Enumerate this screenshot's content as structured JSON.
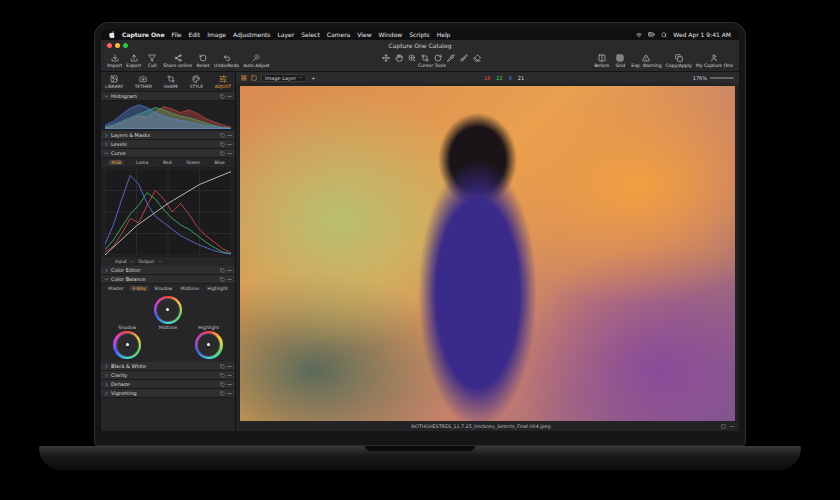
{
  "menu_bar": {
    "app": "Capture One",
    "items": [
      "File",
      "Edit",
      "Image",
      "Adjustments",
      "Layer",
      "Select",
      "Camera",
      "View",
      "Window",
      "Scripts",
      "Help"
    ],
    "clock": "Wed Apr 1  9:41 AM"
  },
  "window": {
    "title": "Capture One Catalog"
  },
  "toolbar": {
    "left": [
      "Import",
      "Export",
      "Cull",
      "Share online",
      "Reset",
      "Undo/Redo",
      "Auto Adjust"
    ],
    "center": "Cursor Tools",
    "right": [
      "Before",
      "Grid",
      "Exp. Warning",
      "Copy/Apply",
      "My Capture One"
    ]
  },
  "viewer_bar": {
    "layer": "Image Layer",
    "add": "+",
    "readings": [
      {
        "value": "24",
        "color": "#e5484d"
      },
      {
        "value": "22",
        "color": "#46c35a"
      },
      {
        "value": "6",
        "color": "#4a8cf0"
      },
      {
        "value": "21",
        "color": "#d8d8d8"
      }
    ],
    "zoom": "176%"
  },
  "tool_tabs": [
    {
      "label": "LIBRARY",
      "selected": false
    },
    {
      "label": "TETHER",
      "selected": false
    },
    {
      "label": "SHAPE",
      "selected": false
    },
    {
      "label": "STYLE",
      "selected": false
    },
    {
      "label": "ADJUST",
      "selected": true
    }
  ],
  "histogram": {
    "title": "Histogram",
    "expanded": true,
    "series": [
      {
        "name": "Red",
        "color": "#e0504a",
        "values": [
          2,
          6,
          14,
          22,
          30,
          28,
          40,
          52,
          46,
          38,
          44,
          36,
          24,
          16,
          10,
          4
        ]
      },
      {
        "name": "Green",
        "color": "#4cc070",
        "values": [
          4,
          10,
          18,
          26,
          34,
          42,
          50,
          44,
          36,
          30,
          26,
          20,
          14,
          8,
          4,
          2
        ]
      },
      {
        "name": "Blue",
        "color": "#5a8cf0",
        "values": [
          8,
          18,
          34,
          48,
          56,
          50,
          38,
          30,
          24,
          20,
          16,
          12,
          8,
          6,
          3,
          1
        ]
      }
    ]
  },
  "sections_top": [
    {
      "title": "Layers & Masks",
      "expanded": false
    },
    {
      "title": "Levels",
      "expanded": false
    }
  ],
  "curve": {
    "title": "Curve",
    "expanded": true,
    "tabs": [
      {
        "label": "RGB",
        "selected": true
      },
      {
        "label": "Luma",
        "selected": false
      },
      {
        "label": "Red",
        "selected": false
      },
      {
        "label": "Green",
        "selected": false
      },
      {
        "label": "Blue",
        "selected": false
      }
    ],
    "series": [
      {
        "name": "Red",
        "color": "#e0504a",
        "values": [
          3,
          8,
          20,
          34,
          30,
          46,
          60,
          52,
          40,
          48,
          38,
          26,
          18,
          12,
          6,
          2
        ]
      },
      {
        "name": "Green",
        "color": "#4cc070",
        "values": [
          5,
          14,
          26,
          38,
          46,
          58,
          52,
          42,
          34,
          28,
          24,
          18,
          12,
          7,
          3,
          1
        ]
      },
      {
        "name": "Blue",
        "color": "#6a7cf0",
        "values": [
          10,
          28,
          52,
          74,
          66,
          48,
          36,
          30,
          24,
          18,
          14,
          10,
          7,
          4,
          2,
          1
        ]
      }
    ],
    "curve": [
      [
        0,
        0
      ],
      [
        0.25,
        0.34
      ],
      [
        0.5,
        0.6
      ],
      [
        0.75,
        0.82
      ],
      [
        1,
        0.97
      ]
    ],
    "input_label": "Input",
    "input_value": "--",
    "output_label": "Output",
    "output_value": "--"
  },
  "color_editor": {
    "title": "Color Editor",
    "expanded": false
  },
  "color_balance": {
    "title": "Color Balance",
    "expanded": true,
    "tabs": [
      {
        "label": "Master",
        "selected": false
      },
      {
        "label": "3-Way",
        "selected": true
      },
      {
        "label": "Shadow",
        "selected": false
      },
      {
        "label": "Midtone",
        "selected": false
      },
      {
        "label": "Highlight",
        "selected": false
      }
    ],
    "wheels": [
      {
        "label": "Midtone"
      },
      {
        "label": "Shadow"
      },
      {
        "label": "Highlight"
      }
    ]
  },
  "sections_bottom": [
    {
      "title": "Black & White",
      "expanded": false
    },
    {
      "title": "Clarity",
      "expanded": false
    },
    {
      "title": "Dehaze",
      "expanded": false
    },
    {
      "title": "Vignetting",
      "expanded": false
    }
  ],
  "caption": "NOTHGHESTRES_11.7.25_Hockney_Selects_Final.004.jpeg"
}
